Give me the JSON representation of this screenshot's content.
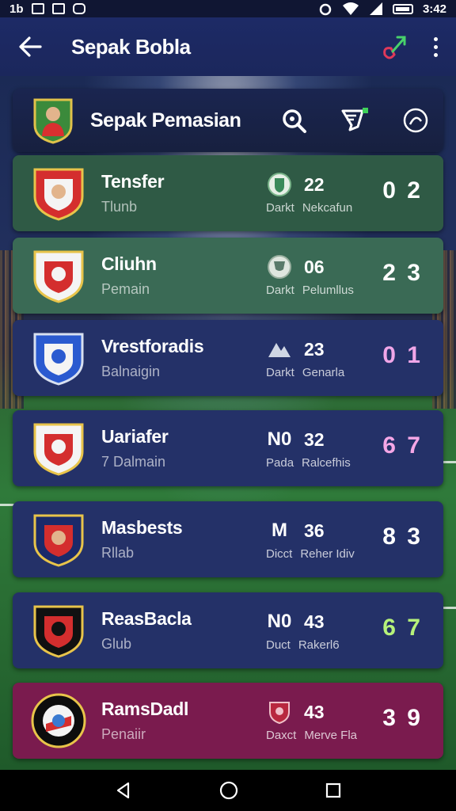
{
  "status_bar": {
    "left_text": "1b",
    "time": "3:42"
  },
  "appbar": {
    "title": "Sepak Bobla"
  },
  "header_card": {
    "title": "Sepak Pemasian"
  },
  "rows": [
    {
      "name": "Tensfer",
      "sub": "Tlunb",
      "mid_icon": "shield-icon",
      "mid_num": "22",
      "mid_label1": "Darkt",
      "mid_label2": "Nekcafun",
      "score": "0 2",
      "score_color": "#ffffff",
      "bg": "#2f5a45"
    },
    {
      "name": "Cliuhn",
      "sub": "Pemain",
      "mid_icon": "cup-icon",
      "mid_num": "06",
      "mid_label1": "Darkt",
      "mid_label2": "Pelumllus",
      "score": "2 3",
      "score_color": "#ffffff",
      "bg": "#3a6a55"
    },
    {
      "name": "Vrestforadis",
      "sub": "Balnaigin",
      "mid_icon": "mountain-icon",
      "mid_num": "23",
      "mid_label1": "Darkt",
      "mid_label2": "Genarla",
      "score": "0 1",
      "score_color": "#f0a6e8",
      "bg": "#243168"
    },
    {
      "name": "Uariafer",
      "sub": "7 Dalmain",
      "mid_icon": "N0",
      "mid_num": "32",
      "mid_label1": "Pada",
      "mid_label2": "Ralcefhis",
      "score": "6 7",
      "score_color": "#f4a6e6",
      "bg": "#243168"
    },
    {
      "name": "Masbests",
      "sub": "Rllab",
      "mid_icon": "M",
      "mid_num": "36",
      "mid_label1": "Dicct",
      "mid_label2": "Reher Idiv",
      "score": "8 3",
      "score_color": "#ffffff",
      "bg": "#243168"
    },
    {
      "name": "ReasBacla",
      "sub": "Glub",
      "mid_icon": "N0",
      "mid_num": "43",
      "mid_label1": "Duct",
      "mid_label2": "Rakerl6",
      "score": "6 7",
      "score_color": "#b6f27a",
      "bg": "#243168"
    },
    {
      "name": "RamsDadl",
      "sub": "Penaiir",
      "mid_icon": "crest-icon",
      "mid_num": "43",
      "mid_label1": "Daxct",
      "mid_label2": "Merve Fla",
      "score": "3 9",
      "score_color": "#ffffff",
      "bg": "#7a1b4e"
    }
  ]
}
